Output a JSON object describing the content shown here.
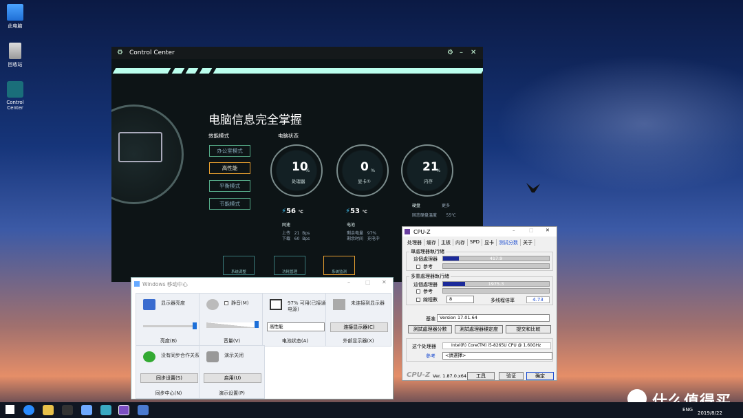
{
  "desktop": {
    "icons": [
      {
        "label": "此电脑"
      },
      {
        "label": "回收站"
      },
      {
        "label": "Control Center"
      }
    ]
  },
  "cc": {
    "title": "Control Center",
    "headline": "电脑信息完全掌握",
    "mode_title": "效能模式",
    "status_title": "电脑状态",
    "modes": [
      "办公室模式",
      "高性能",
      "平衡模式",
      "节能模式"
    ],
    "cpu": {
      "value": "10",
      "unit": "%",
      "label": "处理器"
    },
    "gpu": {
      "value": "0",
      "unit": "%",
      "label": "显卡①"
    },
    "mem": {
      "value": "21",
      "unit": "%",
      "label": "内存"
    },
    "cpu_temp": "56",
    "gpu_temp": "53",
    "temp_unit": "℃",
    "net": {
      "title": "网速",
      "up_label": "上传",
      "up_val": "21",
      "down_label": "下载",
      "down_val": "60",
      "unit": "Bps"
    },
    "battery": {
      "title": "电池",
      "left_label": "剩余电量",
      "left_val": "97%",
      "time_label": "剩余时间",
      "time_val": "充电中"
    },
    "disk": {
      "title": "硬盘",
      "more": "更多",
      "temp_label": "固态硬盘温度",
      "temp_val": "55℃"
    },
    "bottom": [
      "系统调整",
      "功耗管理",
      "系统监测"
    ]
  },
  "mc": {
    "title": "Windows 移动中心",
    "tiles": [
      {
        "label": "显示器亮度",
        "foot": "亮度(B)",
        "level": 0.96
      },
      {
        "label": "静音(M)",
        "foot": "音量(V)",
        "level": 0.93
      },
      {
        "label": "97% 可用(已接通电源)",
        "foot": "电池状态(A)",
        "select": "高性能"
      },
      {
        "label": "未连接到显示器",
        "foot": "外部显示器(X)",
        "button": "连接显示器(C)"
      },
      {
        "label": "没有同步合作关系",
        "foot": "同步中心(N)",
        "button": "同步设置(S)"
      },
      {
        "label": "演示关闭",
        "foot": "演示设置(P)",
        "button": "启用(U)"
      }
    ]
  },
  "cz": {
    "title": "CPU-Z",
    "tabs": [
      "处理器",
      "缓存",
      "主板",
      "内存",
      "SPD",
      "显卡",
      "测试分数",
      "关于"
    ],
    "single_title": "單處理器執行緒",
    "multi_title": "多重處理器執行緒",
    "this_label": "這個處理器",
    "ref_label": "參考",
    "single_val": "417.9",
    "single_frac": 0.15,
    "multi_val": "1975.3",
    "multi_frac": 0.21,
    "threads_label": "線程數",
    "threads_val": "8",
    "ratio_label": "多线程倍率",
    "ratio_val": "4.73",
    "base_label": "基准",
    "base_val": "Version 17.01.64",
    "btn1": "測試處理器分數",
    "btn2": "測試處理器穩定度",
    "btn3": "提交和比較",
    "proc_label": "这个处理器",
    "proc_val": "Intel(R) Core(TM) i5-8265U CPU @ 1.60GHz",
    "ref_sel_label": "參考",
    "ref_sel_val": "<請選擇>",
    "footer_logo": "CPU-Z",
    "ver": "Ver. 1.87.0.x64",
    "tools": "工具",
    "verify": "验证",
    "ok": "确定"
  },
  "taskbar": {
    "lang": "ENG",
    "time": "",
    "date": "2019/8/22"
  },
  "watermark": "什么值得买"
}
